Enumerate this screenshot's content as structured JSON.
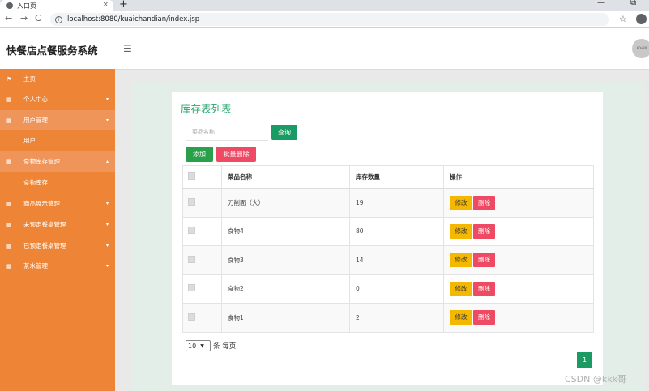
{
  "browser": {
    "tab_title": "入口页",
    "tab_close": "×",
    "new_tab": "+",
    "url": "localhost:8080/kuaichandian/index.jsp",
    "win_min": "—",
    "win_restore": "⧉"
  },
  "header": {
    "app_title": "快餐店点餐服务系统",
    "avatar_text": "80x80"
  },
  "sidebar": {
    "items": [
      {
        "label": "主页",
        "icon": "flag-icon",
        "has_caret": false
      },
      {
        "label": "个人中心",
        "icon": "grid-icon",
        "has_caret": true
      },
      {
        "label": "用户管理",
        "icon": "grid-icon",
        "has_caret": true,
        "active": true
      },
      {
        "label": "用户",
        "sub": true
      },
      {
        "label": "食物库存管理",
        "icon": "grid-icon",
        "has_caret": true,
        "active": true,
        "expanded": true
      },
      {
        "label": "食物库存",
        "sub": true
      },
      {
        "label": "商品展示管理",
        "icon": "grid-icon",
        "has_caret": true
      },
      {
        "label": "未预定餐桌管理",
        "icon": "grid-icon",
        "has_caret": true
      },
      {
        "label": "已预定餐桌管理",
        "icon": "grid-icon",
        "has_caret": true
      },
      {
        "label": "茶水管理",
        "icon": "grid-icon",
        "has_caret": true
      }
    ]
  },
  "main": {
    "title": "库存表列表",
    "search_placeholder": "菜品名称",
    "search_button": "查询",
    "add_button": "添加",
    "batch_delete_button": "批量删除",
    "table": {
      "headers": [
        "菜品名称",
        "库存数量",
        "操作"
      ],
      "rows": [
        {
          "name": "刀削面（大）",
          "qty": "19"
        },
        {
          "name": "食物4",
          "qty": "80"
        },
        {
          "name": "食物3",
          "qty": "14"
        },
        {
          "name": "食物2",
          "qty": "0"
        },
        {
          "name": "食物1",
          "qty": "2"
        }
      ],
      "edit_label": "修改",
      "delete_label": "删除"
    },
    "page_size": "10",
    "page_size_suffix": "条 每页",
    "current_page": "1"
  },
  "watermark": "CSDN @kkk哥",
  "colors": {
    "sidebar_bg": "#ee8536",
    "accent_green": "#1a9b63",
    "title_green": "#28a76e",
    "danger": "#ee4a63",
    "warning": "#f5b800"
  }
}
